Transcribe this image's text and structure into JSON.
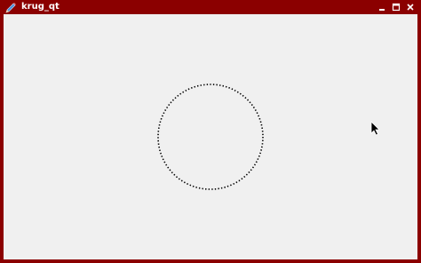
{
  "window": {
    "title": "krug_qt",
    "frame_color": "#8b0000",
    "client_background": "#f0f0f0"
  },
  "titlebar": {
    "app_icon": "pencil-icon",
    "buttons": [
      "minimize-icon",
      "maximize-icon",
      "close-icon"
    ]
  },
  "drawing": {
    "shape": "dotted-circle",
    "stroke_color": "#000000"
  },
  "cursor": {
    "icon": "arrow-cursor-icon"
  }
}
